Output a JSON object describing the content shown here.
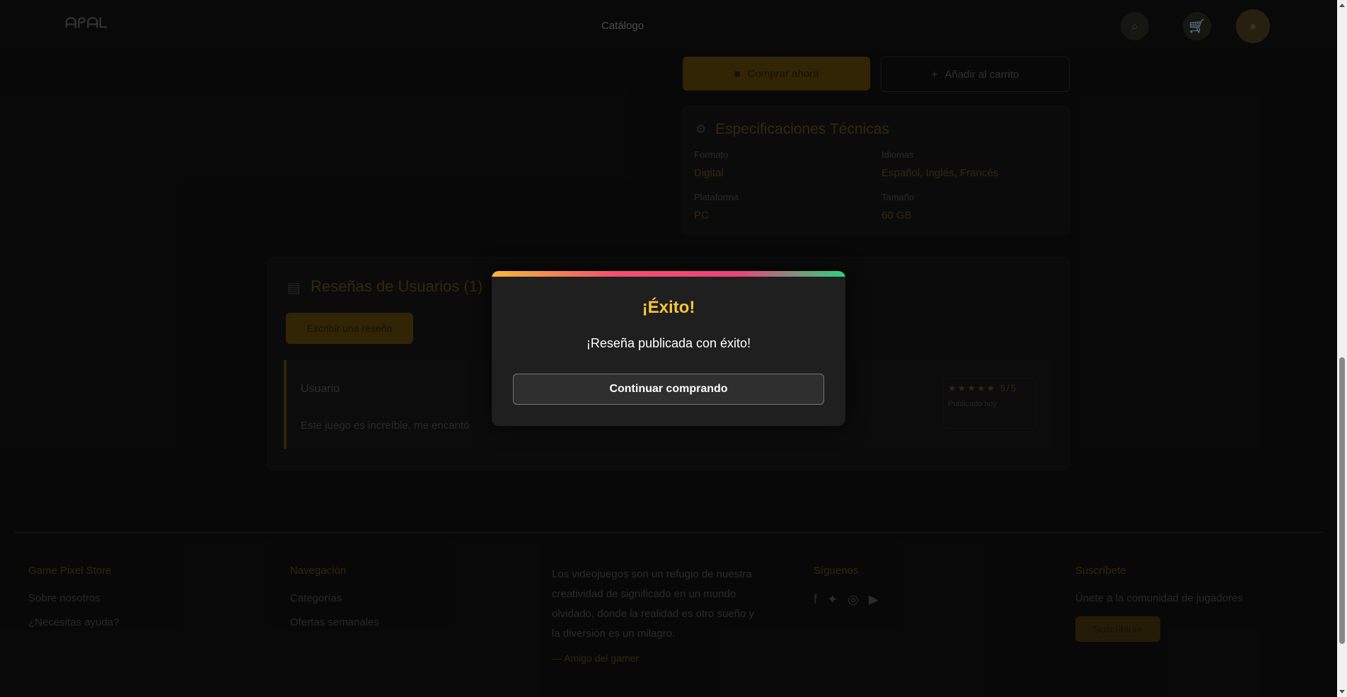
{
  "header": {
    "logo": "ᗩᑭᗩᒪ",
    "nav_catalog": "Catálogo"
  },
  "product": {
    "buy_label": "Comprar ahora",
    "cart_label": "Añadir al carrito",
    "specs": {
      "title": "Especificaciones Técnicas",
      "items": [
        {
          "key": "Formato",
          "value": "Digital"
        },
        {
          "key": "Idiomas",
          "value": "Español, Inglés, Francés"
        },
        {
          "key": "Plataforma",
          "value": "PC"
        },
        {
          "key": "Tamaño",
          "value": "60 GB"
        }
      ]
    }
  },
  "reviews": {
    "title": "Reseñas de Usuarios (1)",
    "write_label": "Escribir una reseña",
    "items": [
      {
        "user": "Usuario",
        "text": "Este juego es increíble, me encantó",
        "stars": "★★★★★ 5/5",
        "date": "Publicado hoy"
      }
    ]
  },
  "footer": {
    "col1": {
      "heading": "Game Pixel Store",
      "links": [
        "Sobre nosotros",
        "¿Necesitas ayuda?"
      ]
    },
    "col2": {
      "heading": "Navegación",
      "links": [
        "Categorías",
        "Ofertas semanales"
      ]
    },
    "quote": {
      "text": "Los videojuegos son un refugio de nuestra creatividad de significado en un mundo olvidado, donde la realidad es otro sueño y la diversión es un milagro.",
      "author": "— Amigo del gamer"
    },
    "col4": {
      "heading": "Síguenos"
    },
    "col5": {
      "heading": "Suscríbete",
      "text": "Únete a la comunidad de jugadores",
      "button": "Suscribirse"
    }
  },
  "modal": {
    "title": "¡Éxito!",
    "message": "¡Reseña publicada con éxito!",
    "button": "Continuar comprando"
  },
  "colors": {
    "accent": "#f5c542",
    "modal_bg": "#1f1f1f"
  }
}
